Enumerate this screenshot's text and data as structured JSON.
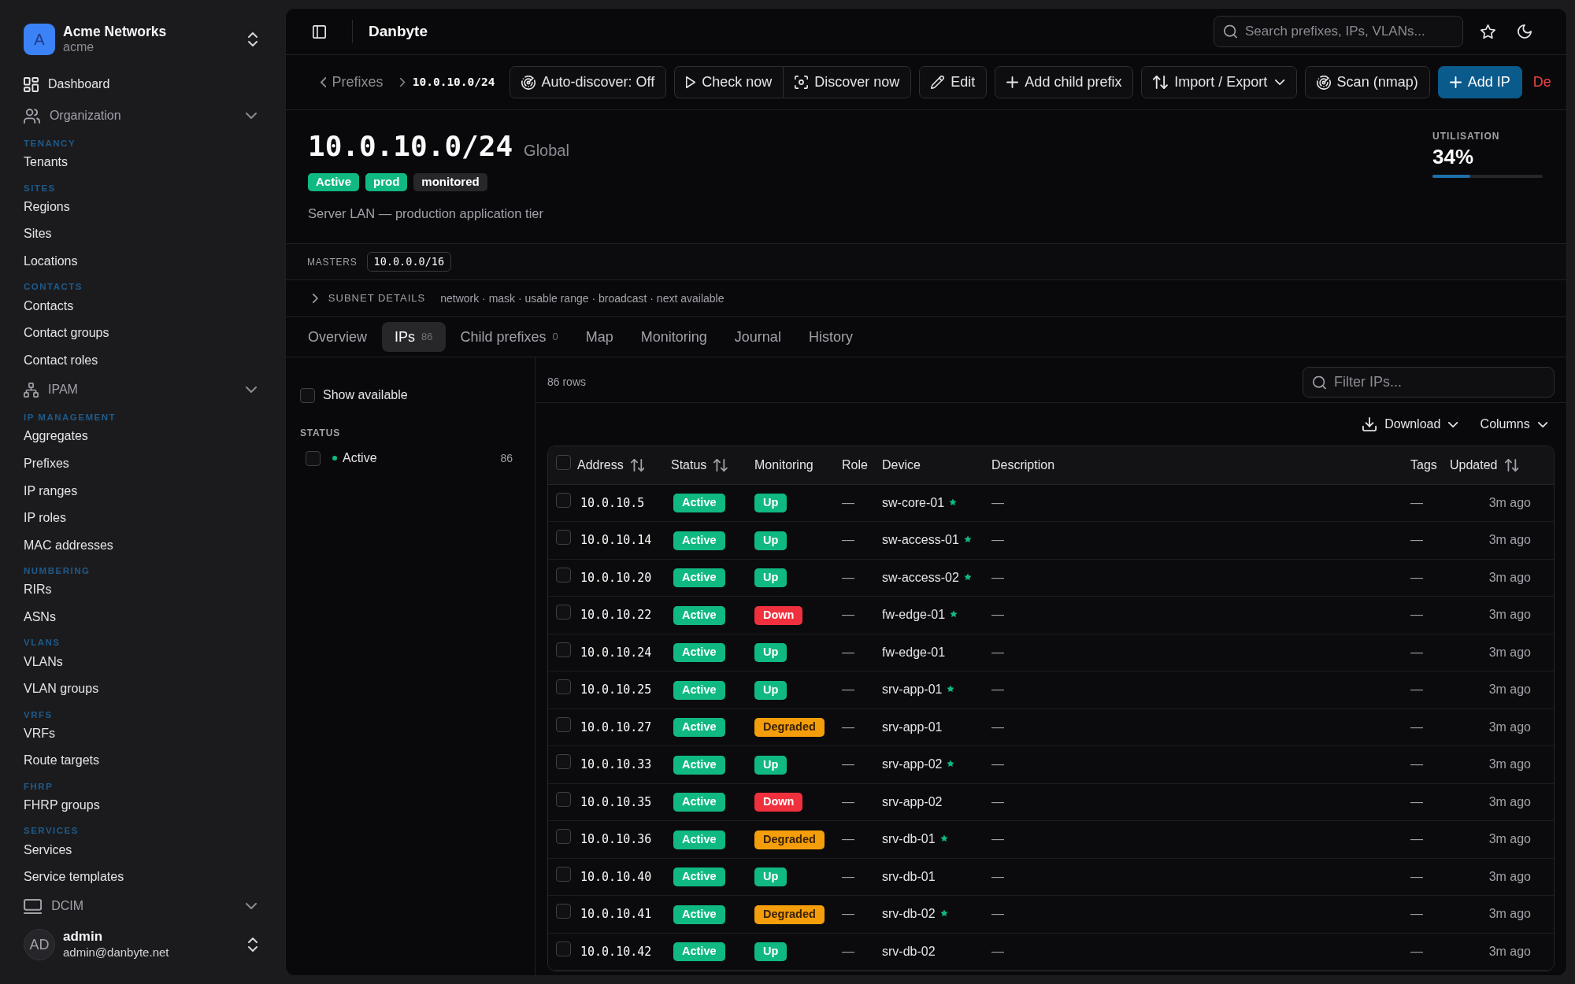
{
  "sidebar": {
    "org": {
      "avatar": "A",
      "name": "Acme Networks",
      "slug": "acme"
    },
    "nav": [
      {
        "kind": "link",
        "label": "Dashboard",
        "selected": false
      },
      {
        "kind": "group",
        "label": "Organization",
        "expanded": true,
        "sections": [
          {
            "heading": "TENANCY",
            "items": [
              {
                "label": "Tenants",
                "selected": false
              }
            ]
          },
          {
            "heading": "SITES",
            "items": [
              {
                "label": "Regions",
                "selected": false
              },
              {
                "label": "Sites",
                "selected": false
              },
              {
                "label": "Locations",
                "selected": false
              }
            ]
          },
          {
            "heading": "CONTACTS",
            "items": [
              {
                "label": "Contacts",
                "selected": false
              },
              {
                "label": "Contact groups",
                "selected": false
              },
              {
                "label": "Contact roles",
                "selected": false
              }
            ]
          }
        ]
      },
      {
        "kind": "group",
        "label": "IPAM",
        "expanded": true,
        "sections": [
          {
            "heading": "IP MANAGEMENT",
            "items": [
              {
                "label": "Aggregates",
                "selected": false
              },
              {
                "label": "Prefixes",
                "selected": false
              },
              {
                "label": "IP ranges",
                "selected": false
              },
              {
                "label": "IP roles",
                "selected": false
              },
              {
                "label": "MAC addresses",
                "selected": false
              }
            ]
          },
          {
            "heading": "NUMBERING",
            "items": [
              {
                "label": "RIRs",
                "selected": false
              },
              {
                "label": "ASNs",
                "selected": false
              }
            ]
          },
          {
            "heading": "VLANS",
            "items": [
              {
                "label": "VLANs",
                "selected": false
              },
              {
                "label": "VLAN groups",
                "selected": false
              }
            ]
          },
          {
            "heading": "VRFS",
            "items": [
              {
                "label": "VRFs",
                "selected": false
              },
              {
                "label": "Route targets",
                "selected": false
              }
            ]
          },
          {
            "heading": "FHRP",
            "items": [
              {
                "label": "FHRP groups",
                "selected": false
              }
            ]
          },
          {
            "heading": "SERVICES",
            "items": [
              {
                "label": "Services",
                "selected": false
              },
              {
                "label": "Service templates",
                "selected": false
              }
            ]
          }
        ]
      },
      {
        "kind": "group",
        "label": "DCIM",
        "expanded": true
      }
    ],
    "user": {
      "avatar": "AD",
      "name": "admin",
      "email": "admin@danbyte.net"
    }
  },
  "topbar": {
    "title": "Danbyte",
    "search": {
      "placeholder": "Search prefixes, IPs, VLANs..."
    }
  },
  "toolbar": {
    "breadcrumb": [
      {
        "kind": "link",
        "label": "Prefixes"
      },
      {
        "kind": "current",
        "label": "10.0.10.0/24"
      }
    ],
    "actions": [
      {
        "kind": "button",
        "label": "Auto-discover: Off"
      },
      {
        "kind": "group",
        "buttons": [
          {
            "label": "Check now"
          },
          {
            "label": "Discover now"
          }
        ]
      },
      {
        "kind": "button",
        "label": "Edit"
      },
      {
        "kind": "button",
        "label": "Add child prefix"
      },
      {
        "kind": "menu",
        "label": "Import / Export"
      },
      {
        "kind": "button",
        "label": "Scan (nmap)"
      },
      {
        "kind": "primary",
        "label": "Add IP"
      },
      {
        "kind": "danger",
        "label": "De"
      }
    ]
  },
  "prefix": {
    "title": "10.0.10.0/24",
    "scope": "Global",
    "tags": [
      {
        "label": "Active",
        "color": "#10b981"
      },
      {
        "label": "prod",
        "color": "#10b981"
      },
      {
        "label": "monitored",
        "color": "#27272a"
      }
    ],
    "description": "Server LAN — production application tier",
    "utilisation": {
      "label": "UTILISATION",
      "value": "34%",
      "level": 0.34
    }
  },
  "masters": {
    "label": "MASTERS",
    "items": [
      "10.0.0.0/16"
    ]
  },
  "subnet_details": {
    "label": "SUBNET DETAILS",
    "summary": "network · mask · usable range · broadcast · next available",
    "expanded": false
  },
  "tabs": [
    {
      "label": "Overview",
      "selected": false
    },
    {
      "label": "IPs",
      "count": "86",
      "selected": true
    },
    {
      "label": "Child prefixes",
      "count": "0",
      "selected": false
    },
    {
      "label": "Map",
      "selected": false
    },
    {
      "label": "Monitoring",
      "selected": false
    },
    {
      "label": "Journal",
      "selected": false
    },
    {
      "label": "History",
      "selected": false
    }
  ],
  "filters": {
    "show_available": {
      "label": "Show available",
      "checked": false
    },
    "status": {
      "heading": "STATUS",
      "options": [
        {
          "label": "Active",
          "count": "86",
          "color": "#10b981",
          "checked": false
        }
      ]
    }
  },
  "table": {
    "row_count": "86 rows",
    "filter": {
      "placeholder": "Filter IPs..."
    },
    "download": "Download",
    "columns_menu": "Columns",
    "select_all": {
      "checked": false
    },
    "columns": [
      {
        "label": "Address",
        "sortable": true
      },
      {
        "label": "Status",
        "sortable": true
      },
      {
        "label": "Monitoring",
        "sortable": false
      },
      {
        "label": "Role",
        "sortable": false
      },
      {
        "label": "Device",
        "sortable": false
      },
      {
        "label": "Description",
        "sortable": false
      },
      {
        "label": "Tags",
        "sortable": false
      },
      {
        "label": "Updated",
        "sortable": true
      }
    ],
    "rows": [
      {
        "checked": false,
        "address": "10.0.10.5",
        "status": {
          "label": "Active",
          "color": "#10b981"
        },
        "monitoring": {
          "label": "Up",
          "color": "#10b981"
        },
        "role": "—",
        "device": "sw-core-01",
        "starred": true,
        "description": "—",
        "tags": "—",
        "updated": "3m ago"
      },
      {
        "checked": false,
        "address": "10.0.10.14",
        "status": {
          "label": "Active",
          "color": "#10b981"
        },
        "monitoring": {
          "label": "Up",
          "color": "#10b981"
        },
        "role": "—",
        "device": "sw-access-01",
        "starred": true,
        "description": "—",
        "tags": "—",
        "updated": "3m ago"
      },
      {
        "checked": false,
        "address": "10.0.10.20",
        "status": {
          "label": "Active",
          "color": "#10b981"
        },
        "monitoring": {
          "label": "Up",
          "color": "#10b981"
        },
        "role": "—",
        "device": "sw-access-02",
        "starred": true,
        "description": "—",
        "tags": "—",
        "updated": "3m ago"
      },
      {
        "checked": false,
        "address": "10.0.10.22",
        "status": {
          "label": "Active",
          "color": "#10b981"
        },
        "monitoring": {
          "label": "Down",
          "color": "#f0303d"
        },
        "role": "—",
        "device": "fw-edge-01",
        "starred": true,
        "description": "—",
        "tags": "—",
        "updated": "3m ago"
      },
      {
        "checked": false,
        "address": "10.0.10.24",
        "status": {
          "label": "Active",
          "color": "#10b981"
        },
        "monitoring": {
          "label": "Up",
          "color": "#10b981"
        },
        "role": "—",
        "device": "fw-edge-01",
        "starred": false,
        "description": "—",
        "tags": "—",
        "updated": "3m ago"
      },
      {
        "checked": false,
        "address": "10.0.10.25",
        "status": {
          "label": "Active",
          "color": "#10b981"
        },
        "monitoring": {
          "label": "Up",
          "color": "#10b981"
        },
        "role": "—",
        "device": "srv-app-01",
        "starred": true,
        "description": "—",
        "tags": "—",
        "updated": "3m ago"
      },
      {
        "checked": false,
        "address": "10.0.10.27",
        "status": {
          "label": "Active",
          "color": "#10b981"
        },
        "monitoring": {
          "label": "Degraded",
          "color": "#f59e0b"
        },
        "role": "—",
        "device": "srv-app-01",
        "starred": false,
        "description": "—",
        "tags": "—",
        "updated": "3m ago"
      },
      {
        "checked": false,
        "address": "10.0.10.33",
        "status": {
          "label": "Active",
          "color": "#10b981"
        },
        "monitoring": {
          "label": "Up",
          "color": "#10b981"
        },
        "role": "—",
        "device": "srv-app-02",
        "starred": true,
        "description": "—",
        "tags": "—",
        "updated": "3m ago"
      },
      {
        "checked": false,
        "address": "10.0.10.35",
        "status": {
          "label": "Active",
          "color": "#10b981"
        },
        "monitoring": {
          "label": "Down",
          "color": "#f0303d"
        },
        "role": "—",
        "device": "srv-app-02",
        "starred": false,
        "description": "—",
        "tags": "—",
        "updated": "3m ago"
      },
      {
        "checked": false,
        "address": "10.0.10.36",
        "status": {
          "label": "Active",
          "color": "#10b981"
        },
        "monitoring": {
          "label": "Degraded",
          "color": "#f59e0b"
        },
        "role": "—",
        "device": "srv-db-01",
        "starred": true,
        "description": "—",
        "tags": "—",
        "updated": "3m ago"
      },
      {
        "checked": false,
        "address": "10.0.10.40",
        "status": {
          "label": "Active",
          "color": "#10b981"
        },
        "monitoring": {
          "label": "Up",
          "color": "#10b981"
        },
        "role": "—",
        "device": "srv-db-01",
        "starred": false,
        "description": "—",
        "tags": "—",
        "updated": "3m ago"
      },
      {
        "checked": false,
        "address": "10.0.10.41",
        "status": {
          "label": "Active",
          "color": "#10b981"
        },
        "monitoring": {
          "label": "Degraded",
          "color": "#f59e0b"
        },
        "role": "—",
        "device": "srv-db-02",
        "starred": true,
        "description": "—",
        "tags": "—",
        "updated": "3m ago"
      },
      {
        "checked": false,
        "address": "10.0.10.42",
        "status": {
          "label": "Active",
          "color": "#10b981"
        },
        "monitoring": {
          "label": "Up",
          "color": "#10b981"
        },
        "role": "—",
        "device": "srv-db-02",
        "starred": false,
        "description": "—",
        "tags": "—",
        "updated": "3m ago"
      }
    ]
  }
}
